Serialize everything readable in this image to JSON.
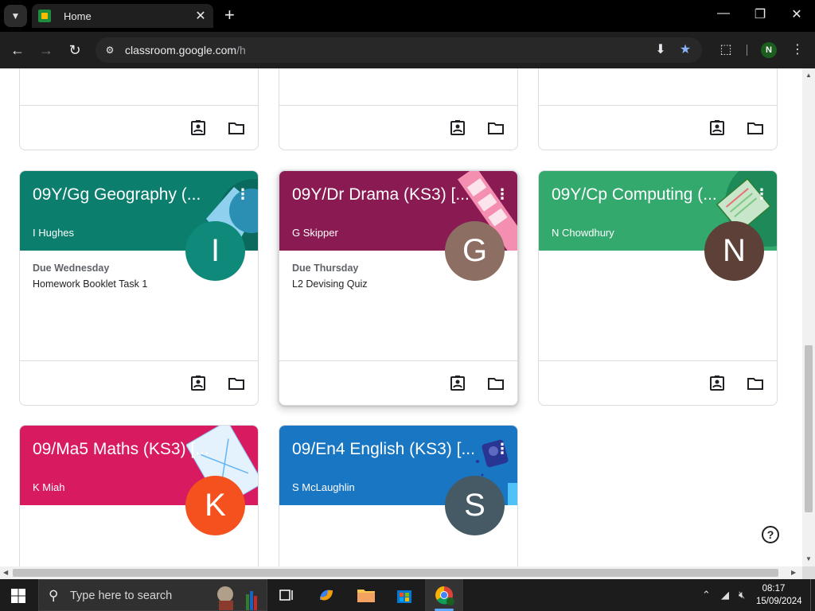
{
  "browser": {
    "tab_title": "Home",
    "url_host": "classroom.google.com",
    "url_path": "/h",
    "profile_initial": "N"
  },
  "page": {
    "rows": [
      {
        "row": "top-partial",
        "cards": [
          {},
          {},
          {}
        ]
      }
    ],
    "courses": [
      {
        "title": "09Y/Gg Geography (...",
        "teacher": "I Hughes",
        "avatar_letter": "I",
        "avatar_color": "#0f8a7a",
        "header_color": "#0b7e6e",
        "due_label": "Due Wednesday",
        "due_item": "Homework Booklet Task 1"
      },
      {
        "title": "09Y/Dr Drama (KS3) [...",
        "teacher": "G Skipper",
        "avatar_letter": "G",
        "avatar_color": "#8d6e63",
        "header_color": "#8a1a52",
        "due_label": "Due Thursday",
        "due_item": "L2 Devising Quiz"
      },
      {
        "title": "09Y/Cp Computing (...",
        "teacher": "N Chowdhury",
        "avatar_letter": "N",
        "avatar_color": "#5d4037",
        "header_color": "#34a96e",
        "due_label": "",
        "due_item": ""
      },
      {
        "title": "09/Ma5 Maths (KS3) [...",
        "teacher": "K Miah",
        "avatar_letter": "K",
        "avatar_color": "#f4511e",
        "header_color": "#d81b60",
        "due_label": "",
        "due_item": ""
      },
      {
        "title": "09/En4 English (KS3) [...",
        "teacher": "S McLaughlin",
        "avatar_letter": "S",
        "avatar_color": "#455a64",
        "header_color": "#1976c2",
        "due_label": "",
        "due_item": ""
      }
    ],
    "help_label": "?"
  },
  "taskbar": {
    "search_placeholder": "Type here to search",
    "time": "08:17",
    "date": "15/09/2024"
  }
}
